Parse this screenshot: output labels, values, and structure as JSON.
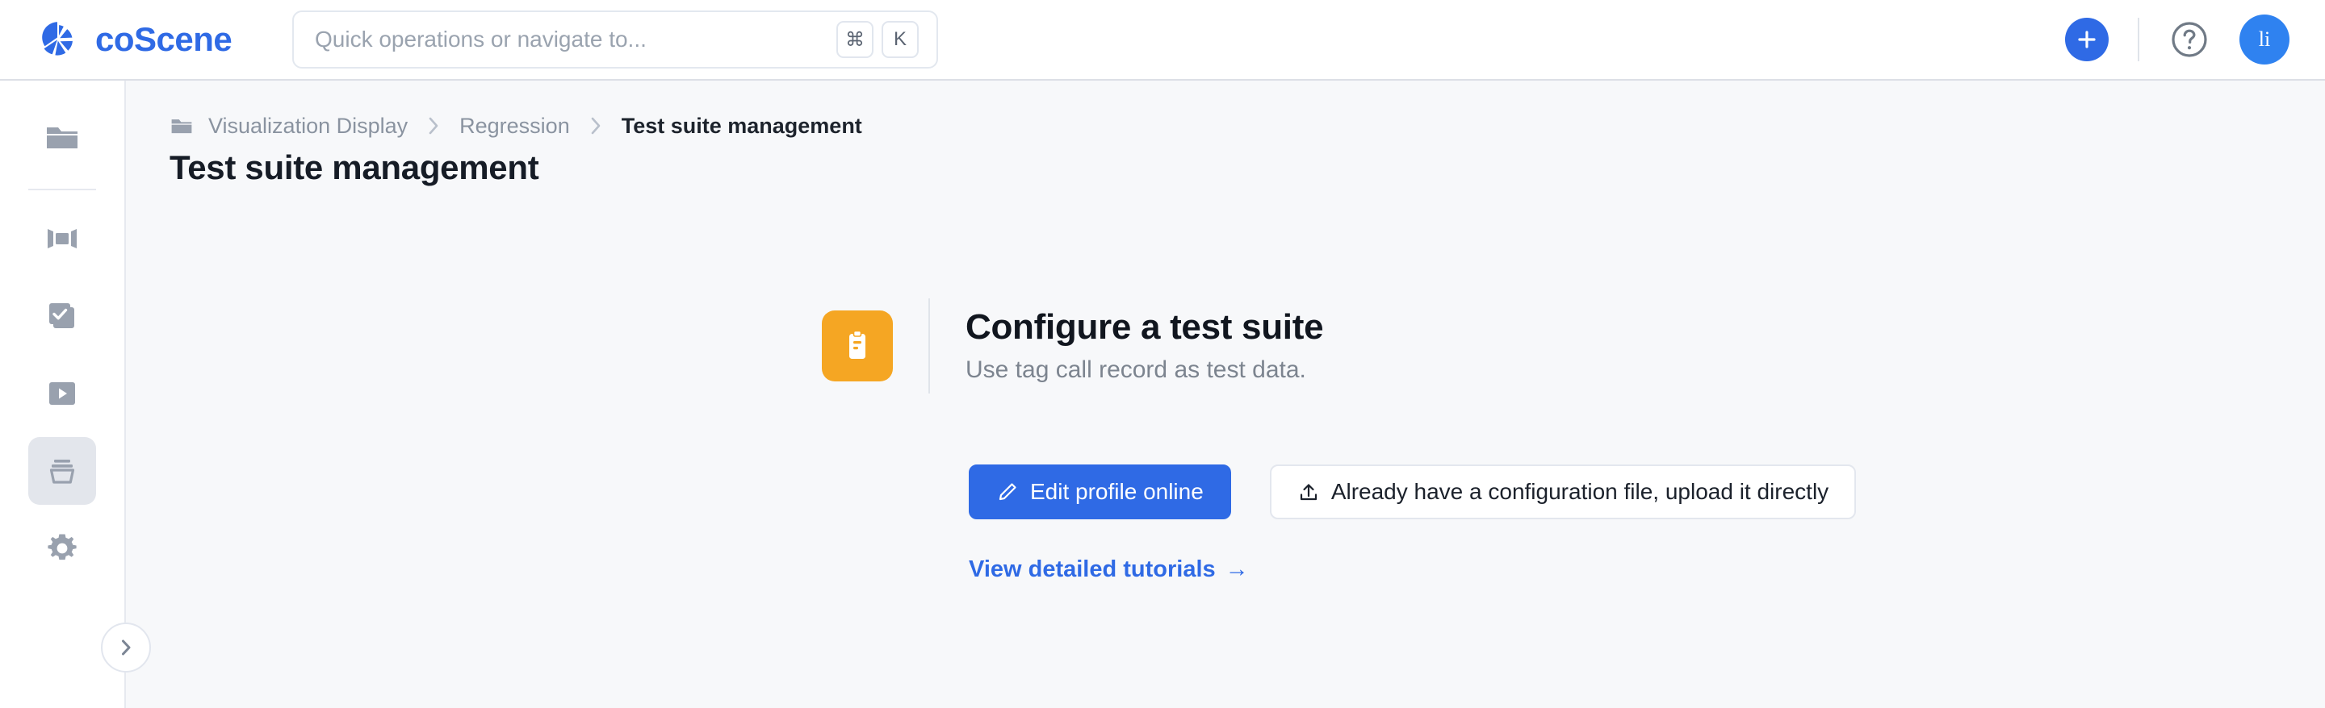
{
  "header": {
    "brand_name": "coScene",
    "brand_logo_icon": "coscene-aperture-logo",
    "search": {
      "placeholder": "Quick operations or navigate to...",
      "value": "",
      "kbd_modifier": "⌘",
      "kbd_key": "K"
    },
    "add_button": {
      "label": "+",
      "icon": "plus-icon"
    },
    "help_button": {
      "icon": "question-circle-icon"
    },
    "avatar": {
      "initials": "li"
    },
    "accent_color": "#2f6ae5"
  },
  "sidebar": {
    "items": [
      {
        "icon": "folder-icon",
        "name": "projects",
        "active": false
      },
      {
        "icon": "device-icon",
        "name": "devices",
        "active": false
      },
      {
        "icon": "tasks-icon",
        "name": "tasks",
        "active": false
      },
      {
        "icon": "play-icon",
        "name": "playback",
        "active": false
      },
      {
        "icon": "archive-icon",
        "name": "storage",
        "active": true
      },
      {
        "icon": "gear-icon",
        "name": "settings",
        "active": false
      }
    ],
    "collapse_button": {
      "icon": "chevron-right-icon"
    }
  },
  "breadcrumb": {
    "folder_icon": "folder-icon",
    "items": [
      {
        "label": "Visualization Display",
        "current": false
      },
      {
        "label": "Regression",
        "current": false
      },
      {
        "label": "Test suite management",
        "current": true
      }
    ],
    "separator": "›"
  },
  "page": {
    "title": "Test suite management"
  },
  "empty_state": {
    "icon": "clipboard-icon",
    "icon_color": "#f5a623",
    "title": "Configure a test suite",
    "subtitle": "Use tag call record as test data.",
    "primary_button": {
      "label": "Edit profile online",
      "icon": "pencil-icon"
    },
    "secondary_button": {
      "label": "Already have a configuration file, upload it directly",
      "icon": "upload-icon"
    },
    "link": {
      "label": "View detailed tutorials",
      "arrow": "→"
    }
  }
}
